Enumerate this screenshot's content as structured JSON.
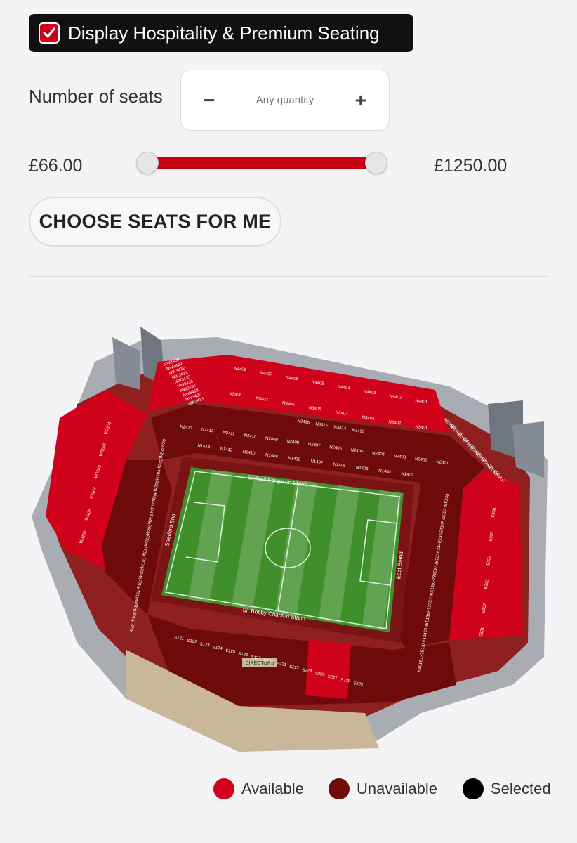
{
  "filters": {
    "hospitality_label": "Display Hospitality & Premium Seating",
    "hospitality_checked": true,
    "seats_label": "Number of seats",
    "seats_minus": "−",
    "seats_plus": "+",
    "seats_placeholder": "Any quantity",
    "price_min": "£66.00",
    "price_max": "£1250.00",
    "choose_button": "CHOOSE SEATS FOR ME"
  },
  "stadium": {
    "stand_labels": {
      "north": "Sir Alex Ferguson Stand",
      "south": "Sir Bobby Charlton Stand",
      "west": "Stretford End",
      "east": "East Stand"
    },
    "directors_label": "DIRECTORS",
    "sections": {
      "north_upper": [
        "N4408",
        "N4407",
        "N4406",
        "N4405",
        "N4404",
        "N4403",
        "N4402",
        "N4401"
      ],
      "north_mid": [
        "N3408",
        "N3407",
        "N3406",
        "N3405",
        "N3404",
        "N3403",
        "N3402",
        "N3401"
      ],
      "north_box": [
        "N3416",
        "N3415",
        "N3414",
        "N3413"
      ],
      "north_lower": [
        "N2413",
        "N2412",
        "N2411",
        "N2410",
        "N2409",
        "N2408",
        "N2407",
        "N2406",
        "N2405",
        "N2404",
        "N2403",
        "N2402",
        "N2401"
      ],
      "north_pitch": [
        "N1413",
        "N1412",
        "N1410",
        "N1409",
        "N1408",
        "N1407",
        "N1406",
        "N1405",
        "N1404",
        "N1403"
      ],
      "northwest": [
        "NW3430",
        "NW3429",
        "NW3432",
        "NW3431",
        "NW3435",
        "NW3436",
        "NW3434",
        "NW3428",
        "NW3427",
        "NW3433"
      ],
      "northeast": [
        "NE3422",
        "NE3421",
        "NE3424",
        "NE3426",
        "NE3420",
        "NE3419",
        "NE3423",
        "NE3418",
        "NE3417"
      ],
      "west_upper": [
        "W3101",
        "W3102",
        "W3103",
        "W3104",
        "W3105",
        "W3106"
      ],
      "west_lower": [
        "W201",
        "W202",
        "W203",
        "W204",
        "W205",
        "W206",
        "W207",
        "W208",
        "W209",
        "W210",
        "W211",
        "W101",
        "W102",
        "W103",
        "W104",
        "W105",
        "W106",
        "W10"
      ],
      "east_upper": [
        "E336",
        "E335",
        "E334",
        "E333",
        "E332",
        "E331"
      ],
      "east_lower": [
        "E239",
        "E238",
        "E237",
        "E236",
        "E235",
        "E234",
        "E233",
        "E232",
        "E231",
        "E139",
        "E138",
        "E137",
        "E136",
        "E135",
        "E134",
        "E133",
        "E132",
        "E101"
      ],
      "south": [
        "S121",
        "S122",
        "S123",
        "S124",
        "S125",
        "S126",
        "S127",
        "S128",
        "S221",
        "S222",
        "S223",
        "S226",
        "S227",
        "S228",
        "S229"
      ]
    },
    "colors": {
      "available": "#d0021b",
      "unavailable": "#6e0a0a",
      "selected": "#000000",
      "pitch": "#3f8f2a",
      "roof": "#9aa0a8"
    }
  },
  "legend": [
    {
      "label": "Available",
      "color": "#d0021b"
    },
    {
      "label": "Unavailable",
      "color": "#6e0a0a"
    },
    {
      "label": "Selected",
      "color": "#000000"
    }
  ]
}
